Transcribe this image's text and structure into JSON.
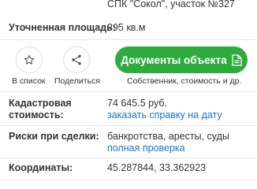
{
  "top": {
    "address": "СПК \"Сокол\", участок №327"
  },
  "area": {
    "label": "Уточненная площадь:",
    "value": "395 кв.м"
  },
  "actions": {
    "favorite_label": "В список",
    "share_label": "Поделиться",
    "documents_button": "Документы объекта",
    "documents_sub": "Собственник, стоимость и др."
  },
  "cadastral": {
    "label_line1": "Кадастровая",
    "label_line2": "стоимость:",
    "value": "74 645.5 руб.",
    "link": "заказать справку на дату"
  },
  "risks": {
    "label": "Риски при сделки:",
    "value": "банкротства, аресты, суды",
    "link": "полная проверка"
  },
  "coords": {
    "label": "Координаты:",
    "value": "45.287844, 33.362923"
  },
  "colors": {
    "accent_green": "#2eab3e",
    "link_blue": "#1a73c9",
    "text": "#333333"
  }
}
